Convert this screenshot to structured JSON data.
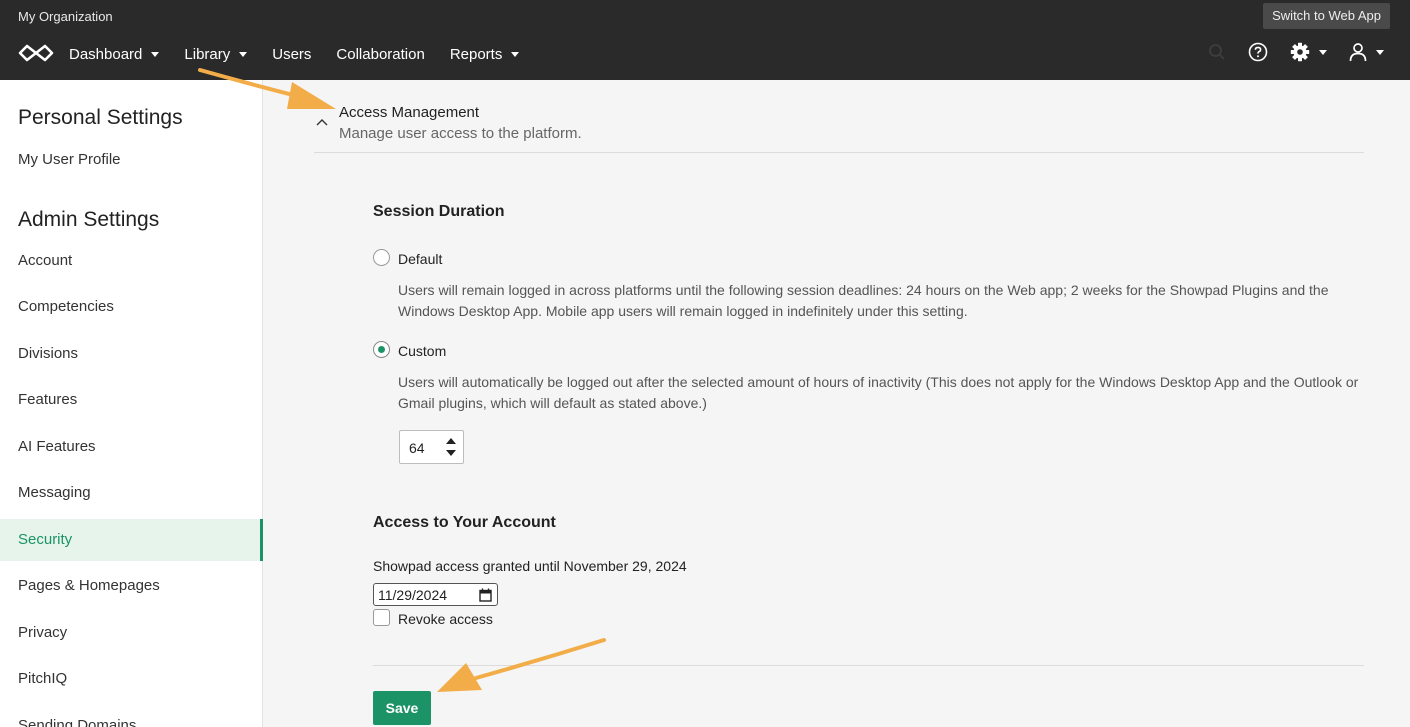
{
  "topbar": {
    "org_name": "My Organization",
    "switch_label": "Switch to Web App",
    "nav": [
      {
        "label": "Dashboard",
        "has_dropdown": true
      },
      {
        "label": "Library",
        "has_dropdown": true
      },
      {
        "label": "Users",
        "has_dropdown": false
      },
      {
        "label": "Collaboration",
        "has_dropdown": false
      },
      {
        "label": "Reports",
        "has_dropdown": true
      }
    ],
    "icons": [
      "search-icon",
      "help-icon",
      "gear-icon",
      "user-icon"
    ]
  },
  "sidebar": {
    "personal_heading": "Personal Settings",
    "personal_items": [
      {
        "label": "My User Profile"
      }
    ],
    "admin_heading": "Admin Settings",
    "admin_items": [
      {
        "label": "Account"
      },
      {
        "label": "Competencies"
      },
      {
        "label": "Divisions"
      },
      {
        "label": "Features"
      },
      {
        "label": "AI Features"
      },
      {
        "label": "Messaging"
      },
      {
        "label": "Security",
        "active": true
      },
      {
        "label": "Pages & Homepages"
      },
      {
        "label": "Privacy"
      },
      {
        "label": "PitchIQ"
      },
      {
        "label": "Sending Domains"
      }
    ]
  },
  "section": {
    "title": "Access Management",
    "description": "Manage user access to the platform."
  },
  "session": {
    "heading": "Session Duration",
    "default_label": "Default",
    "default_desc": "Users will remain logged in across platforms until the following session deadlines: 24 hours on the Web app; 2 weeks for the Showpad Plugins and the Windows Desktop App. Mobile app users will remain logged in indefinitely under this setting.",
    "custom_label": "Custom",
    "custom_desc": "Users will automatically be logged out after the selected amount of hours of inactivity (This does not apply for the Windows Desktop App and the Outlook or Gmail plugins, which will default as stated above.)",
    "selected": "custom",
    "hours_value": "64"
  },
  "account_access": {
    "heading": "Access to Your Account",
    "granted_text": "Showpad access granted until November 29, 2024",
    "date_value": "11/29/2024",
    "revoke_label": "Revoke access",
    "revoke_checked": false
  },
  "save_label": "Save",
  "colors": {
    "topbar": "#2a2a2a",
    "accent": "#1c9366",
    "active_bg": "#e6f4ec",
    "annotation_arrow": "#f2ac48"
  }
}
